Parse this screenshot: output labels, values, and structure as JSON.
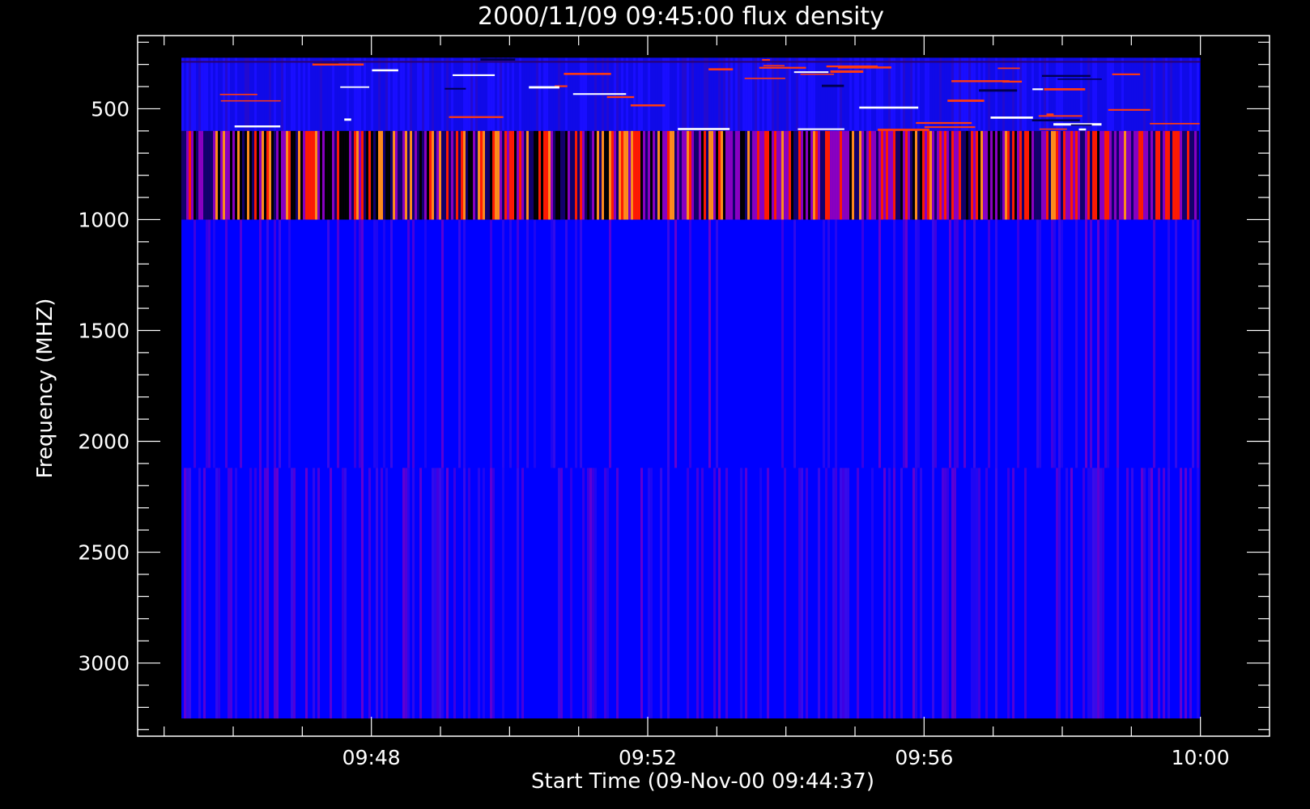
{
  "chart_data": {
    "type": "heatmap",
    "title": "2000/11/09 09:45:00 flux density",
    "xlabel": "Start Time (09-Nov-00 09:44:37)",
    "ylabel": "Frequency (MHZ)",
    "x_tick_labels": [
      "09:48",
      "09:52",
      "09:56",
      "10:00"
    ],
    "y_tick_labels": [
      "500",
      "1000",
      "1500",
      "2000",
      "2500",
      "3000"
    ],
    "x_range": [
      "09:44:37",
      "10:01:00"
    ],
    "y_range_mhz": [
      170,
      3330
    ],
    "y_axis_inverted": true,
    "data_extent": {
      "time_start": "09:45:15",
      "time_end": "10:00:00",
      "freq_min_mhz": 270,
      "freq_max_mhz": 3250
    },
    "bands": [
      {
        "freq_from_mhz": 270,
        "freq_to_mhz": 600,
        "description": "noisy blue band with thin horizontal red/white streaks",
        "level": "low-medium"
      },
      {
        "freq_from_mhz": 600,
        "freq_to_mhz": 1000,
        "description": "vertical striations ranging black to red/orange, intensifying after 09:50",
        "level": "high, variable"
      },
      {
        "freq_from_mhz": 1000,
        "freq_to_mhz": 2120,
        "description": "uniform blue with faint purple striations",
        "level": "low"
      },
      {
        "freq_from_mhz": 2120,
        "freq_to_mhz": 3250,
        "description": "blue with stronger purple striations",
        "level": "low"
      }
    ],
    "colormap": [
      "#000000",
      "#0000ff",
      "#8a00c0",
      "#ff1a00",
      "#ff8c1a",
      "#ffffff"
    ],
    "grid": false,
    "legend": "none"
  }
}
